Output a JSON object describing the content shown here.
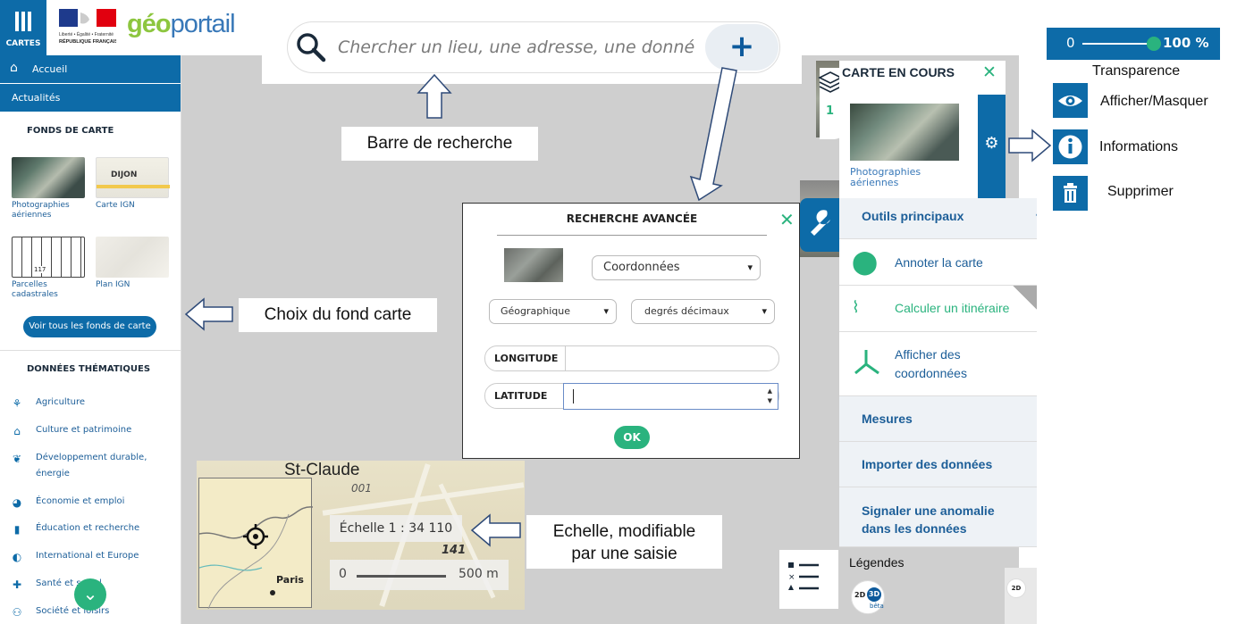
{
  "header": {
    "menu_label": "CARTES",
    "brand_geo": "géo",
    "brand_portail": "portail",
    "rf_line1": "Liberté • Égalité • Fraternité",
    "rf_line2": "RÉPUBLIQUE FRANÇAISE"
  },
  "search": {
    "placeholder": "Chercher un lieu, une adresse, une donnée",
    "plus_label": "+"
  },
  "sidebar": {
    "home": "Accueil",
    "news": "Actualités",
    "fonds_title": "FONDS DE CARTE",
    "fonds": [
      {
        "label_l1": "Photographies",
        "label_l2": "aériennes"
      },
      {
        "label_l1": "Carte IGN",
        "label_l2": "",
        "thumb_text": "DIJON"
      },
      {
        "label_l1": "Parcelles",
        "label_l2": "cadastrales",
        "thumb_text": "117"
      },
      {
        "label_l1": "Plan IGN",
        "label_l2": ""
      }
    ],
    "voir_tous": "Voir tous les fonds de carte",
    "themes_title": "DONNÉES THÉMATIQUES",
    "themes": [
      {
        "label": "Agriculture",
        "icon": "wheat-icon"
      },
      {
        "label": "Culture et patrimoine",
        "icon": "museum-icon"
      },
      {
        "label": "Développement durable, énergie",
        "icon": "leaf-hand-icon"
      },
      {
        "label": "Économie et emploi",
        "icon": "pie-icon"
      },
      {
        "label": "Éducation et recherche",
        "icon": "book-icon"
      },
      {
        "label": "International et Europe",
        "icon": "globe-icon"
      },
      {
        "label": "Santé et social",
        "icon": "medkit-icon"
      },
      {
        "label": "Société et loisirs",
        "icon": "people-icon"
      }
    ]
  },
  "callouts": {
    "search": "Barre de recherche",
    "fond": "Choix du fond carte",
    "echelle_l1": "Echelle, modifiable",
    "echelle_l2": "par une saisie"
  },
  "advanced_search": {
    "title": "RECHERCHE AVANCÉE",
    "type_value": "Coordonnées",
    "system_value": "Géographique",
    "unit_value": "degrés décimaux",
    "longitude_label": "LONGITUDE",
    "latitude_label": "LATITUDE",
    "longitude_value": "",
    "latitude_value": "",
    "ok_label": "OK"
  },
  "map_overlay": {
    "place_name": "St-Claude",
    "mini_map_label": "Paris",
    "scale_text": "Échelle 1 : 34 110",
    "scale_zero": "0",
    "scale_distance": "500 m",
    "map_number_1": "141",
    "map_number_2": "001"
  },
  "current_map": {
    "title": "CARTE EN COURS",
    "layer_count": "1",
    "layer_label_l1": "Photographies",
    "layer_label_l2": "aériennes"
  },
  "tools": {
    "main_header": "Outils principaux",
    "items": [
      {
        "label_l1": "Annoter la carte",
        "label_l2": ""
      },
      {
        "label_l1": "Calculer un itinéraire",
        "label_l2": ""
      },
      {
        "label_l1": "Afficher des",
        "label_l2": "coordonnées"
      }
    ],
    "mesures": "Mesures",
    "importer": "Importer des données",
    "signaler_l1": "Signaler une anomalie",
    "signaler_l2": "dans les données",
    "legendes": "Légendes",
    "btn_2d": "2D",
    "btn_3d": "3D",
    "btn_beta": "bêta"
  },
  "opacity": {
    "min_label": "0",
    "value": "100 %",
    "level": 1.0,
    "transparence_label": "Transparence"
  },
  "layer_actions": {
    "show_hide": "Afficher/Masquer",
    "info": "Informations",
    "delete": "Supprimer"
  },
  "colors": {
    "primary_blue": "#0d6ba8",
    "accent_green": "#2ab37e",
    "brand_green": "#8dc63f",
    "brand_blue": "#3878b8"
  }
}
